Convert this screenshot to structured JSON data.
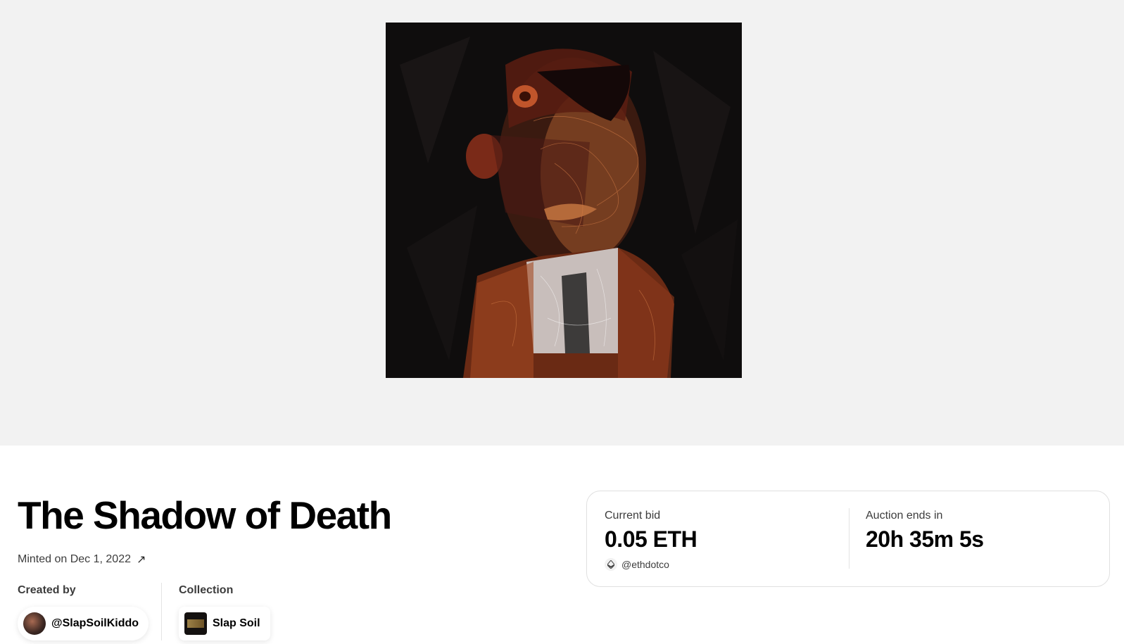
{
  "artwork": {
    "description_icon": "portrait-artwork-icon"
  },
  "title": "The Shadow of Death",
  "minted": {
    "label": "Minted on Dec 1, 2022",
    "arrow": "↗"
  },
  "creator": {
    "label": "Created by",
    "handle": "@SlapSoilKiddo",
    "avatar_icon": "user-avatar-icon"
  },
  "collection": {
    "label": "Collection",
    "name": "Slap Soil",
    "thumb_icon": "collection-thumbnail-icon"
  },
  "auction": {
    "current_bid_label": "Current bid",
    "current_bid_value": "0.05 ETH",
    "bidder_handle": "@ethdotco",
    "bidder_icon": "ethereum-icon",
    "ends_label": "Auction ends in",
    "ends_value": "20h 35m 5s"
  },
  "colors": {
    "hero_background": "#f2f2f2",
    "card_border": "#e0e0e0"
  }
}
